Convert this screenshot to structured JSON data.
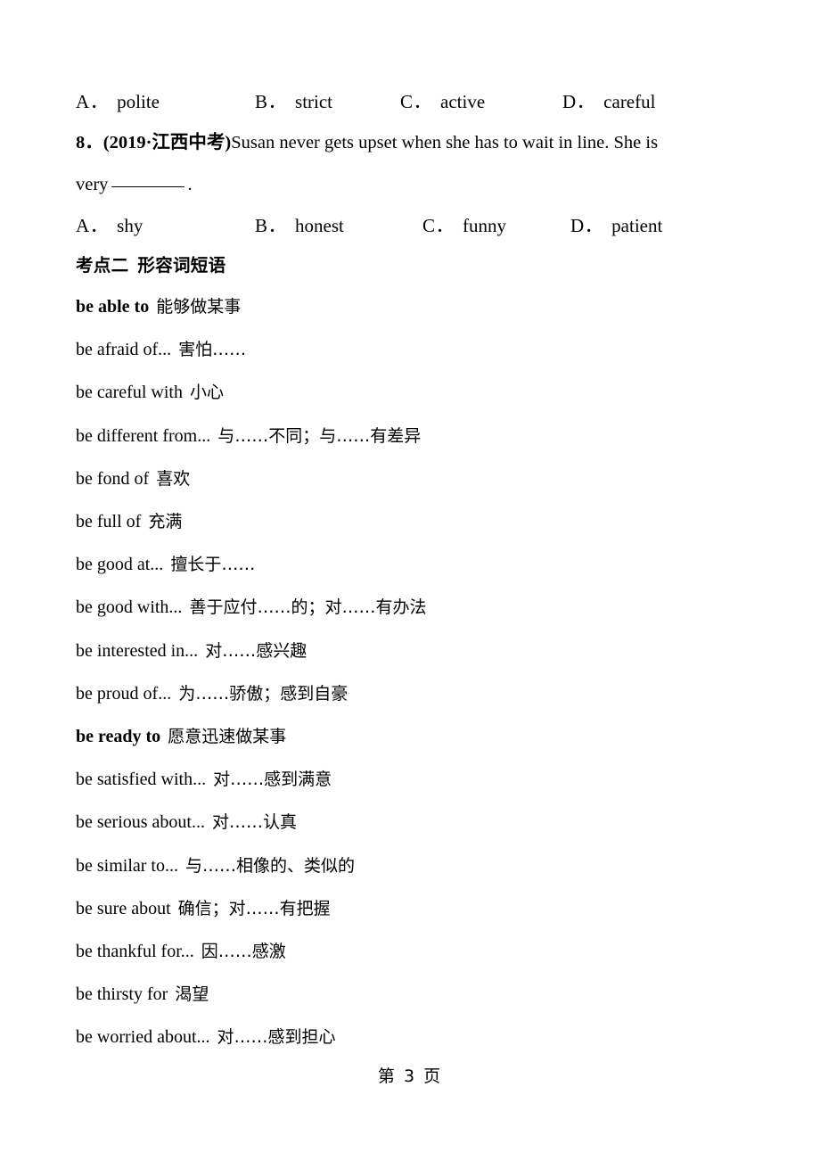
{
  "page": {
    "footer_label": "第 3 页",
    "page_number": "3"
  },
  "question_7_options": {
    "a_label": "A．",
    "a_text": "polite",
    "b_label": "B．",
    "b_text": "strict",
    "c_label": "C．",
    "c_text": "active",
    "d_label": "D．",
    "d_text": "careful"
  },
  "question_8": {
    "number": "8．",
    "source": "(2019·江西中考)",
    "stem_part1": "Susan never gets upset when she has to wait in line. She is",
    "stem_part2_before": "very",
    "stem_part2_after": ".",
    "options": {
      "a_label": "A．",
      "a_text": "shy",
      "b_label": "B．",
      "b_text": "honest",
      "c_label": "C．",
      "c_text": "funny",
      "d_label": "D．",
      "d_text": "patient"
    }
  },
  "section": {
    "kaodian": "考点二",
    "title": "形容词短语"
  },
  "phrases": [
    {
      "en": "be able to",
      "bold": true,
      "cn": "能够做某事"
    },
    {
      "en": "be afraid of...",
      "bold": false,
      "cn": "害怕……"
    },
    {
      "en": "be careful with",
      "bold": false,
      "cn": "小心"
    },
    {
      "en": "be different from...",
      "bold": false,
      "cn": "与……不同；与……有差异"
    },
    {
      "en": "be fond of",
      "bold": false,
      "cn": "喜欢"
    },
    {
      "en": "be full of",
      "bold": false,
      "cn": "充满"
    },
    {
      "en": "be good at...",
      "bold": false,
      "cn": "擅长于……"
    },
    {
      "en": "be good with...",
      "bold": false,
      "cn": "善于应付……的；对……有办法"
    },
    {
      "en": "be interested in...",
      "bold": false,
      "cn": "对……感兴趣"
    },
    {
      "en": "be proud of...",
      "bold": false,
      "cn": "为……骄傲；感到自豪"
    },
    {
      "en": "be ready to",
      "bold": true,
      "cn": "愿意迅速做某事"
    },
    {
      "en": "be satisfied with...",
      "bold": false,
      "cn": "对……感到满意"
    },
    {
      "en": "be serious about...",
      "bold": false,
      "cn": "对……认真"
    },
    {
      "en": "be similar to...",
      "bold": false,
      "cn": "与……相像的、类似的"
    },
    {
      "en": "be sure about",
      "bold": false,
      "cn": "确信；对……有把握"
    },
    {
      "en": "be thankful for...",
      "bold": false,
      "cn": "因……感激"
    },
    {
      "en": "be thirsty for",
      "bold": false,
      "cn": "渴望"
    },
    {
      "en": "be worried about...",
      "bold": false,
      "cn": "对……感到担心"
    }
  ]
}
